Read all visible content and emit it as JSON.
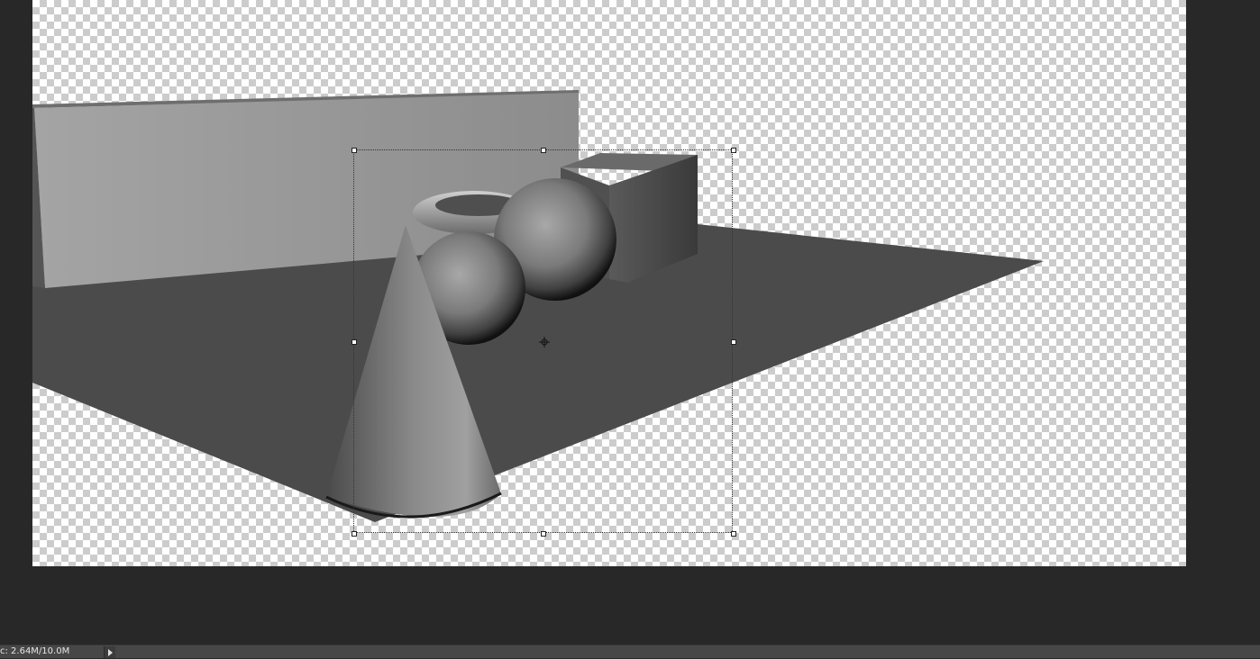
{
  "status_bar": {
    "doc_info": "c: 2.64M/10.0M",
    "menu_arrow_icon": "triangle-right-icon"
  },
  "canvas": {
    "background": "transparency-checkerboard",
    "selection": "free-transform-bounding-box",
    "reference_point_icon": "crosshair-icon"
  },
  "scene_objects": [
    "wall",
    "floor-plane",
    "torus",
    "sphere",
    "sphere",
    "cube",
    "cone"
  ],
  "colors": {
    "workspace": "#282828",
    "status_bar": "#474747",
    "floor": "#4b4b4b",
    "wall": "#9a9a9a"
  }
}
